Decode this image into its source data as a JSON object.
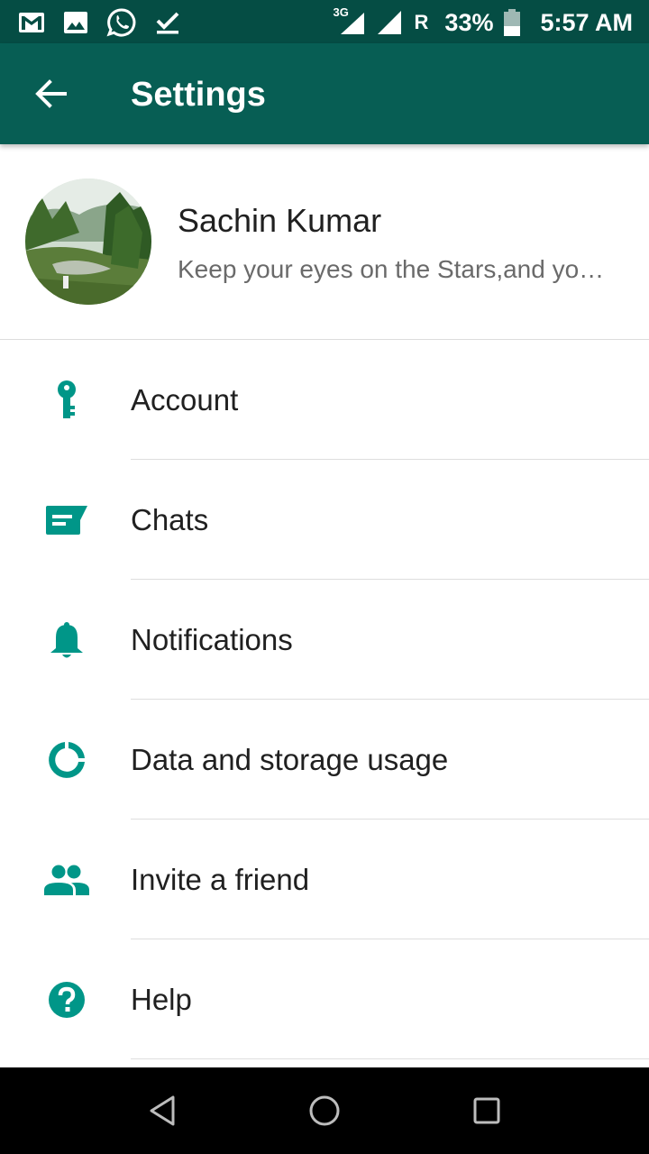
{
  "status_bar": {
    "network_type": "3G",
    "roaming": "R",
    "battery": "33%",
    "time": "5:57 AM",
    "icons": [
      "gmail-icon",
      "gallery-icon",
      "whatsapp-icon",
      "task-done-icon",
      "signal-3g-icon",
      "signal-icon",
      "battery-icon"
    ]
  },
  "toolbar": {
    "title": "Settings",
    "back_icon": "arrow-back-icon"
  },
  "profile": {
    "name": "Sachin Kumar",
    "status": "Keep your eyes on the Stars,and yo…"
  },
  "menu": {
    "items": [
      {
        "label": "Account",
        "icon": "key-icon"
      },
      {
        "label": "Chats",
        "icon": "chat-icon"
      },
      {
        "label": "Notifications",
        "icon": "bell-icon"
      },
      {
        "label": "Data and storage usage",
        "icon": "data-usage-icon"
      },
      {
        "label": "Invite a friend",
        "icon": "people-icon"
      },
      {
        "label": "Help",
        "icon": "help-icon"
      }
    ]
  },
  "nav_bar": {
    "icons": [
      "back-triangle-icon",
      "home-circle-icon",
      "recents-square-icon"
    ]
  },
  "colors": {
    "status_bar": "#054d44",
    "toolbar": "#075e54",
    "accent": "#009688",
    "nav_bar": "#000000"
  }
}
